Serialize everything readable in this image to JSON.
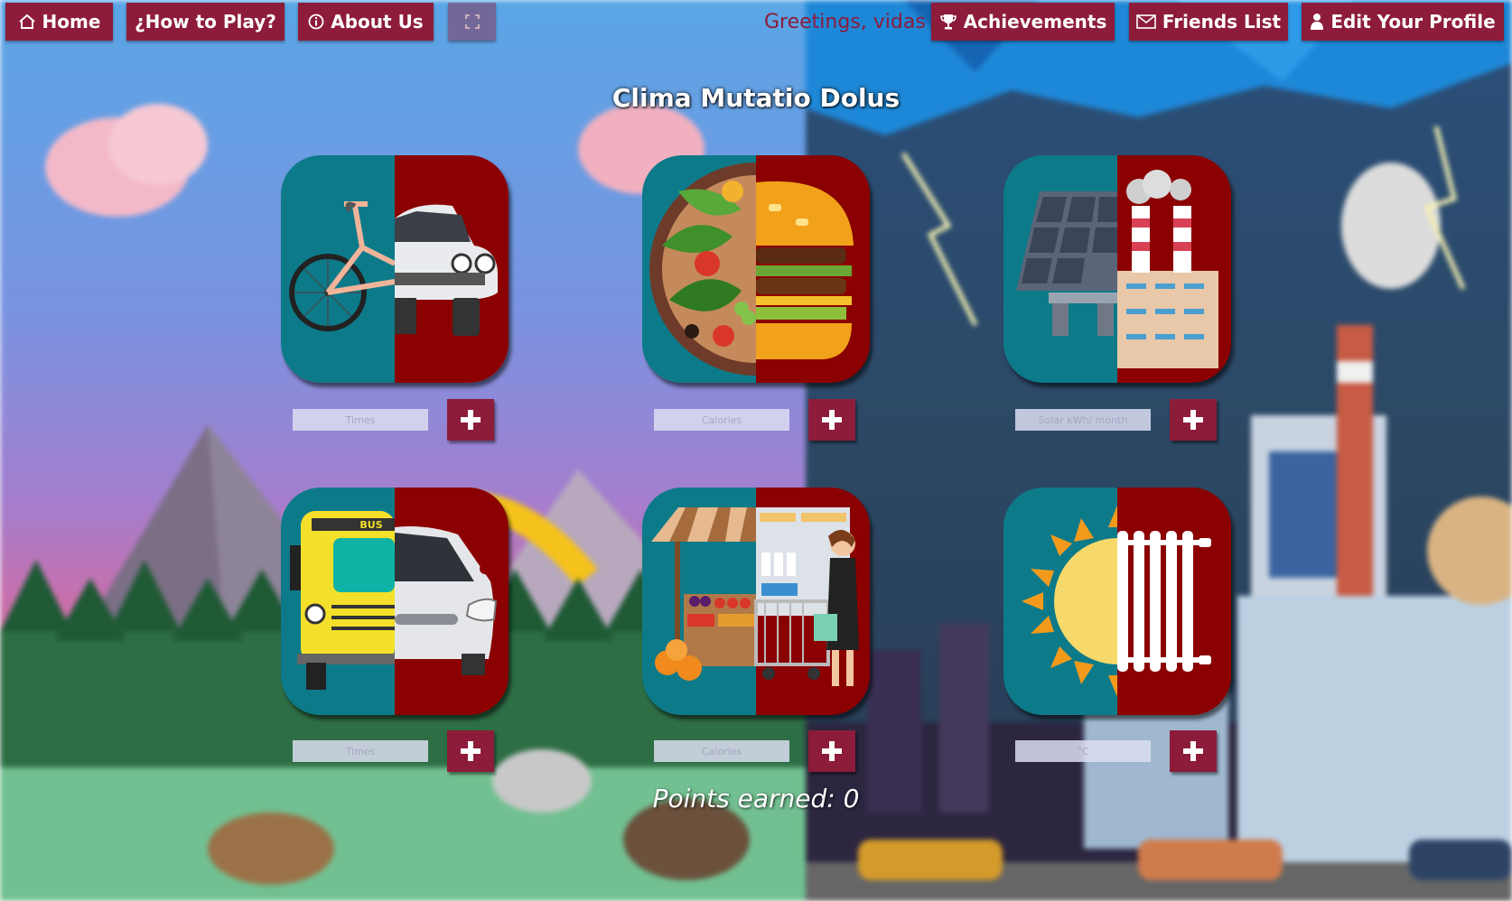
{
  "nav": {
    "home": "Home",
    "how_to_play": "¿How to Play?",
    "about_us": "About Us",
    "greeting": "Greetings, vidas",
    "achievements": "Achievements",
    "friends": "Friends List",
    "profile": "Edit Your Profile"
  },
  "title": "Clima Mutatio Dolus",
  "cards": [
    {
      "name": "bike-vs-car",
      "placeholder": "Times",
      "icon": "bike-car-icon"
    },
    {
      "name": "salad-vs-burger",
      "placeholder": "Calories",
      "icon": "salad-burger-icon"
    },
    {
      "name": "solar-vs-factory",
      "placeholder": "Solar kWh/ month",
      "icon": "solar-factory-icon"
    },
    {
      "name": "bus-vs-car",
      "placeholder": "Times",
      "icon": "bus-car-icon"
    },
    {
      "name": "market-vs-supermarket",
      "placeholder": "Calories",
      "icon": "market-supermarket-icon"
    },
    {
      "name": "sun-vs-heater",
      "placeholder": "°C",
      "icon": "sun-radiator-icon"
    }
  ],
  "points": {
    "label": "Points earned:",
    "value": "0"
  },
  "colors": {
    "accent": "#8d1c3a",
    "teal": "#0d7a8a",
    "red": "#8b0000"
  }
}
